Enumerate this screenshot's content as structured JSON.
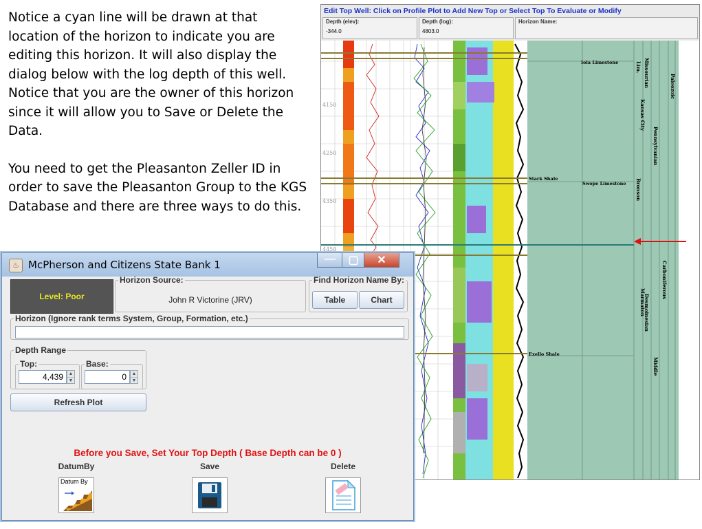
{
  "note": {
    "paragraphs": [
      "Notice a cyan line will be drawn at that location of the horizon to indicate you are editing this horizon.  It will also display the dialog below with the log depth of this well. Notice that you are the owner of this horizon since it will allow you to Save or Delete the Data.",
      "You need to get the Pleasanton Zeller ID in order to save the Pleasanton Group to the KGS Database and there are three ways to do this."
    ]
  },
  "log_panel": {
    "title": "Edit Top Well: Click on Profile Plot to Add New Top or Select Top To Evaluate or Modify",
    "fields": [
      {
        "label": "Depth (elev):",
        "value": "-344.0"
      },
      {
        "label": "Depth (log):",
        "value": "4803.0"
      },
      {
        "label": "Horizon Name:",
        "value": ""
      }
    ],
    "depth_ticks": [
      "4150",
      "4250",
      "4350",
      "4450"
    ],
    "tops": [
      "Iola Limestone",
      "Stark Shale",
      "Swope Limestone",
      "Exello Shale"
    ],
    "strat_labels": [
      "Lim.",
      "Kansas City",
      "Missourian",
      "Pennsylvanian",
      "Paleozoic",
      "Bronson",
      "Desmoinesian",
      "Marmaton",
      "Carboniferous",
      "Middle"
    ],
    "colors": {
      "cyan_line": "#2a7a7a",
      "arrow": "#e01010",
      "strat_bg": "#9cc8b4"
    }
  },
  "dialog": {
    "title": "McPherson and Citizens State Bank 1",
    "level": "Level: Poor",
    "horizon_source": {
      "legend": "Horizon Source:",
      "value": "John R Victorine (JRV)"
    },
    "find_by": {
      "legend": "Find Horizon Name By:",
      "table": "Table",
      "chart": "Chart"
    },
    "horizon": {
      "legend": "Horizon (Ignore rank terms System, Group, Formation, etc.)",
      "value": ""
    },
    "depth_range": {
      "legend": "Depth Range",
      "top_label": "Top:",
      "top_value": "4,439",
      "base_label": "Base:",
      "base_value": "0"
    },
    "refresh": "Refresh Plot",
    "warning": "Before you Save, Set Your Top Depth ( Base Depth can be 0 )",
    "actions": [
      {
        "label": "DatumBy",
        "icon": "datum-by-icon",
        "icon_text": "Datum By"
      },
      {
        "label": "Save",
        "icon": "floppy-disk-icon"
      },
      {
        "label": "Delete",
        "icon": "delete-document-icon"
      }
    ]
  }
}
